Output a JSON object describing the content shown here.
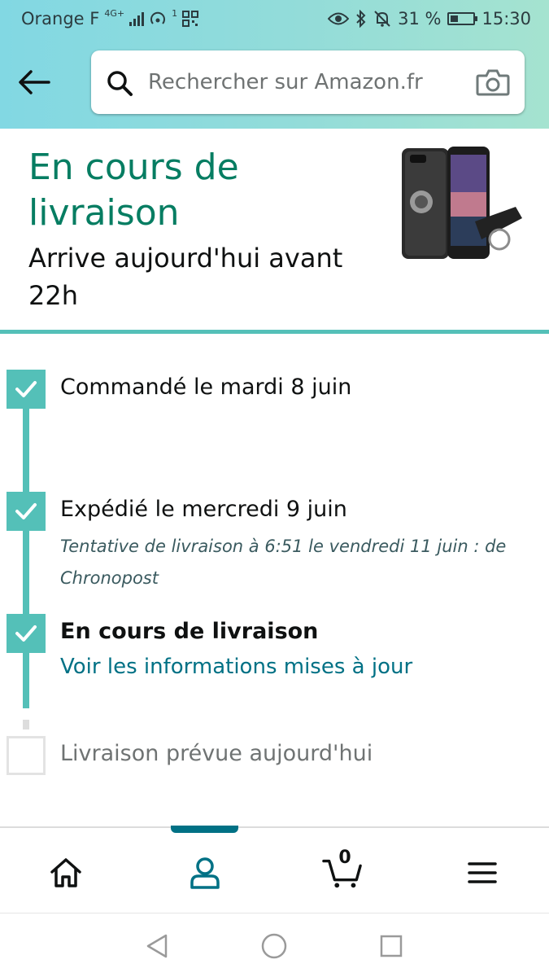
{
  "status_bar": {
    "carrier": "Orange F",
    "network_type": "4G+",
    "network_sub": "1",
    "battery_percent": "31 %",
    "time": "15:30"
  },
  "search": {
    "placeholder": "Rechercher sur Amazon.fr"
  },
  "delivery": {
    "status_title": "En cours de livraison",
    "arrival_text": "Arrive aujourd'hui avant 22h"
  },
  "timeline": {
    "step1": {
      "label": "Commandé le mardi 8 juin",
      "done": true
    },
    "step2": {
      "label": "Expédié le mercredi 9 juin",
      "note": "Tentative de livraison à 6:51 le vendredi 11 juin : de Chronopost",
      "done": true
    },
    "step3": {
      "label": "En cours de livraison",
      "link": "Voir les informations mises à jour",
      "done": true
    },
    "step4": {
      "label": "Livraison prévue aujourd'hui",
      "done": false
    }
  },
  "bottom_nav": {
    "cart_count": "0",
    "active": "account"
  },
  "colors": {
    "accent": "#54c0b8",
    "title_green": "#067d62",
    "link_teal": "#007185"
  }
}
